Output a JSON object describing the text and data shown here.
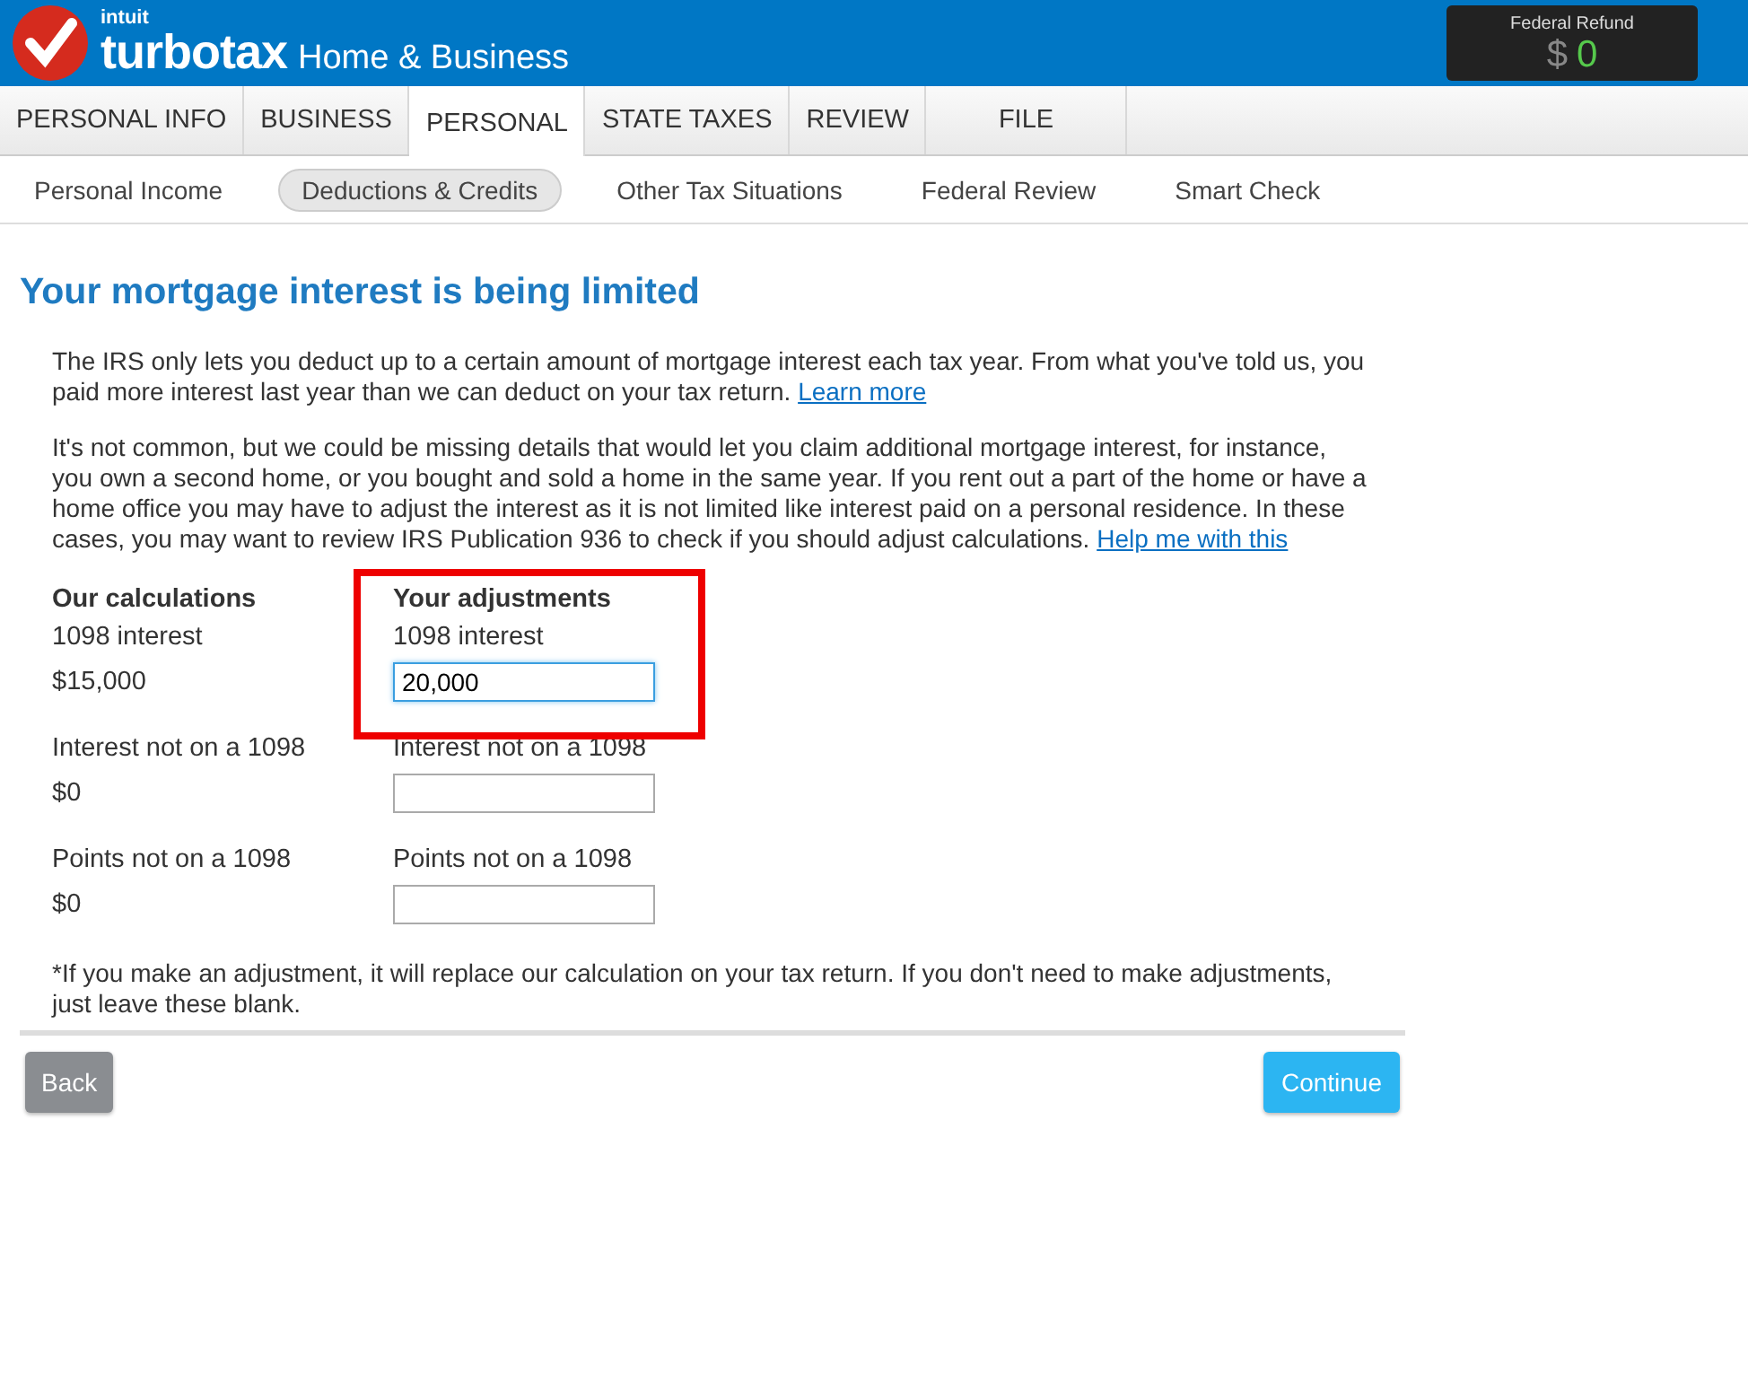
{
  "header": {
    "brand_top": "intuit",
    "brand": "turbotax",
    "edition": "Home & Business",
    "refund": {
      "label": "Federal Refund",
      "currency": "$",
      "amount": "0"
    }
  },
  "tabs": [
    {
      "label": "PERSONAL INFO",
      "selected": false
    },
    {
      "label": "BUSINESS",
      "selected": false
    },
    {
      "label": "PERSONAL",
      "selected": true
    },
    {
      "label": "STATE TAXES",
      "selected": false
    },
    {
      "label": "REVIEW",
      "selected": false
    },
    {
      "label": "FILE",
      "selected": false
    }
  ],
  "subnav": [
    {
      "label": "Personal Income",
      "selected": false
    },
    {
      "label": "Deductions & Credits",
      "selected": true
    },
    {
      "label": "Other Tax Situations",
      "selected": false
    },
    {
      "label": "Federal Review",
      "selected": false
    },
    {
      "label": "Smart Check",
      "selected": false
    }
  ],
  "title": "Your mortgage interest is being limited",
  "intro": {
    "text": "The IRS only lets you deduct up to a certain amount of mortgage interest each tax year. From what you've told us, you paid more interest last year than we can deduct on your tax return.",
    "link": "Learn more"
  },
  "details": {
    "text": "It's not common, but we could be missing details that would let you claim additional mortgage interest, for instance, you own a second home, or you bought and sold a home in the same year. If you rent out a part of the home or have a home office you may have to adjust the interest as it is not limited like interest paid on a personal residence. In these cases, you may want to review IRS Publication 936 to check if you should adjust calculations.",
    "link": "Help me with this"
  },
  "columns": {
    "ours": "Our calculations",
    "yours": "Your adjustments"
  },
  "rows": [
    {
      "label_ours": "1098 interest",
      "value": "$15,000",
      "label_yours": "1098 interest",
      "input": "20,000",
      "highlighted": true
    },
    {
      "label_ours": "Interest not on a 1098",
      "value": "$0",
      "label_yours": "Interest not on a 1098",
      "input": "",
      "highlighted": false
    },
    {
      "label_ours": "Points not on a 1098",
      "value": "$0",
      "label_yours": "Points not on a 1098",
      "input": "",
      "highlighted": false
    }
  ],
  "note": "*If you make an adjustment, it will replace our calculation on your tax return. If you don't need to make adjustments, just leave these blank.",
  "buttons": {
    "back": "Back",
    "continue": "Continue"
  }
}
